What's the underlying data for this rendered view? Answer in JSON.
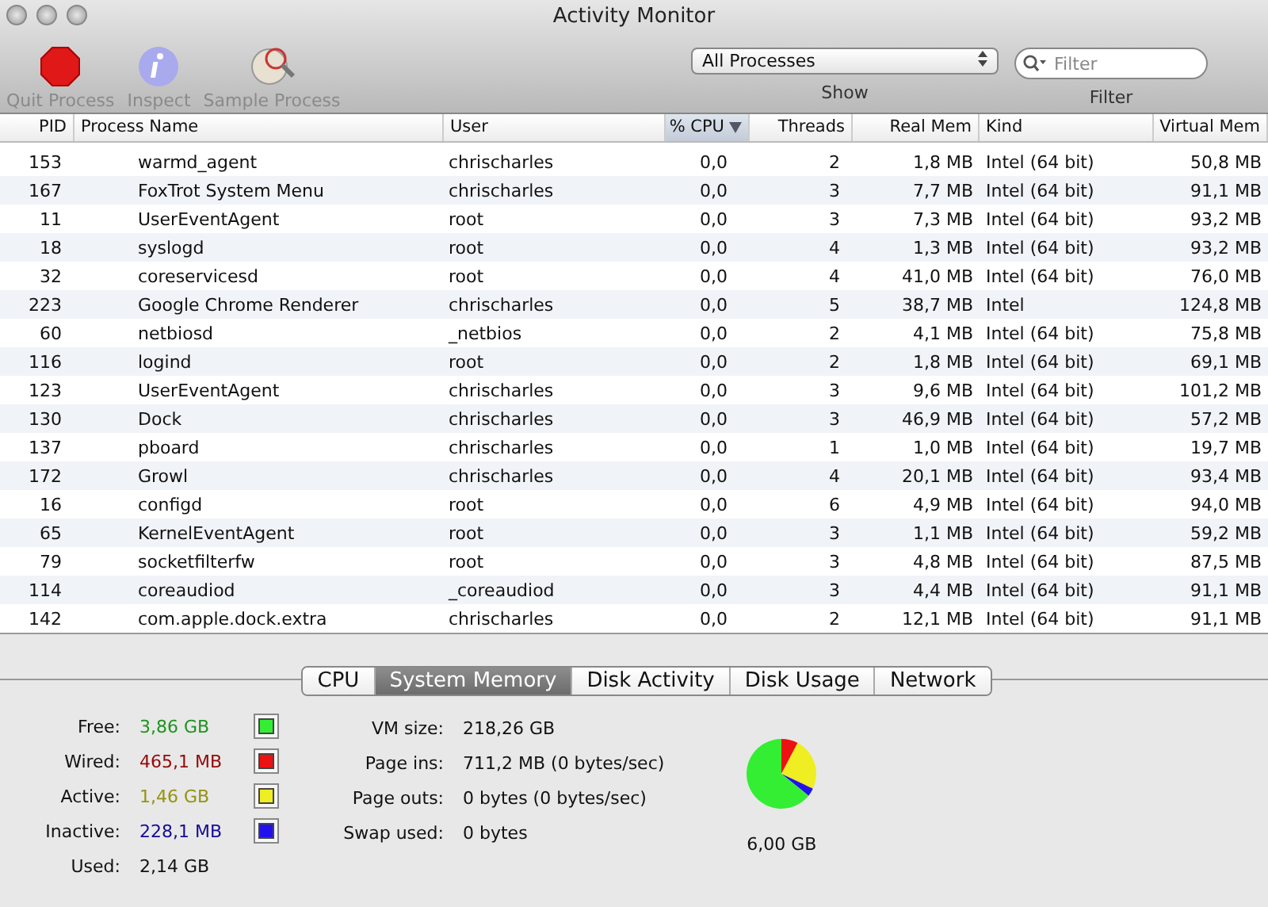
{
  "window": {
    "title": "Activity Monitor"
  },
  "toolbar": {
    "buttons": [
      {
        "label": "Quit Process",
        "kind": "quit",
        "disabled": true
      },
      {
        "label": "Inspect",
        "kind": "inspect",
        "disabled": true
      },
      {
        "label": "Sample Process",
        "kind": "sample",
        "disabled": true
      }
    ],
    "show": {
      "value": "All Processes",
      "label": "Show"
    },
    "filter": {
      "placeholder": "Filter",
      "label": "Filter"
    }
  },
  "table": {
    "columns": [
      {
        "label": "PID",
        "selected": false
      },
      {
        "label": "Process Name",
        "selected": false
      },
      {
        "label": "User",
        "selected": false
      },
      {
        "label": "% CPU",
        "selected": true
      },
      {
        "label": "Threads",
        "selected": false
      },
      {
        "label": "Real Mem",
        "selected": false
      },
      {
        "label": "Kind",
        "selected": false
      },
      {
        "label": "Virtual Mem",
        "selected": false
      }
    ],
    "rows": [
      [
        "153",
        "warmd_agent",
        "chrischarles",
        "0,0",
        "2",
        "1,8 MB",
        "Intel (64 bit)",
        "50,8 MB"
      ],
      [
        "167",
        "FoxTrot System Menu",
        "chrischarles",
        "0,0",
        "3",
        "7,7 MB",
        "Intel (64 bit)",
        "91,1 MB"
      ],
      [
        "11",
        "UserEventAgent",
        "root",
        "0,0",
        "3",
        "7,3 MB",
        "Intel (64 bit)",
        "93,2 MB"
      ],
      [
        "18",
        "syslogd",
        "root",
        "0,0",
        "4",
        "1,3 MB",
        "Intel (64 bit)",
        "93,2 MB"
      ],
      [
        "32",
        "coreservicesd",
        "root",
        "0,0",
        "4",
        "41,0 MB",
        "Intel (64 bit)",
        "76,0 MB"
      ],
      [
        "223",
        "Google Chrome Renderer",
        "chrischarles",
        "0,0",
        "5",
        "38,7 MB",
        "Intel",
        "124,8 MB"
      ],
      [
        "60",
        "netbiosd",
        "_netbios",
        "0,0",
        "2",
        "4,1 MB",
        "Intel (64 bit)",
        "75,8 MB"
      ],
      [
        "116",
        "logind",
        "root",
        "0,0",
        "2",
        "1,8 MB",
        "Intel (64 bit)",
        "69,1 MB"
      ],
      [
        "123",
        "UserEventAgent",
        "chrischarles",
        "0,0",
        "3",
        "9,6 MB",
        "Intel (64 bit)",
        "101,2 MB"
      ],
      [
        "130",
        "Dock",
        "chrischarles",
        "0,0",
        "3",
        "46,9 MB",
        "Intel (64 bit)",
        "57,2 MB"
      ],
      [
        "137",
        "pboard",
        "chrischarles",
        "0,0",
        "1",
        "1,0 MB",
        "Intel (64 bit)",
        "19,7 MB"
      ],
      [
        "172",
        "Growl",
        "chrischarles",
        "0,0",
        "4",
        "20,1 MB",
        "Intel (64 bit)",
        "93,4 MB"
      ],
      [
        "16",
        "configd",
        "root",
        "0,0",
        "6",
        "4,9 MB",
        "Intel (64 bit)",
        "94,0 MB"
      ],
      [
        "65",
        "KernelEventAgent",
        "root",
        "0,0",
        "3",
        "1,1 MB",
        "Intel (64 bit)",
        "59,2 MB"
      ],
      [
        "79",
        "socketfilterfw",
        "root",
        "0,0",
        "3",
        "4,8 MB",
        "Intel (64 bit)",
        "87,5 MB"
      ],
      [
        "114",
        "coreaudiod",
        "_coreaudiod",
        "0,0",
        "3",
        "4,4 MB",
        "Intel (64 bit)",
        "91,1 MB"
      ],
      [
        "142",
        "com.apple.dock.extra",
        "chrischarles",
        "0,0",
        "2",
        "12,1 MB",
        "Intel (64 bit)",
        "91,1 MB"
      ]
    ]
  },
  "tabs": [
    {
      "label": "CPU",
      "selected": false
    },
    {
      "label": "System Memory",
      "selected": true
    },
    {
      "label": "Disk Activity",
      "selected": false
    },
    {
      "label": "Disk Usage",
      "selected": false
    },
    {
      "label": "Network",
      "selected": false
    }
  ],
  "memory": {
    "items": [
      {
        "label": "Free:",
        "value": "3,86 GB",
        "color": "#33ee33"
      },
      {
        "label": "Wired:",
        "value": "465,1 MB",
        "color": "#ee1111"
      },
      {
        "label": "Active:",
        "value": "1,46 GB",
        "color": "#eeee22"
      },
      {
        "label": "Inactive:",
        "value": "228,1 MB",
        "color": "#2211ee"
      },
      {
        "label": "Used:",
        "value": "2,14 GB"
      }
    ],
    "stats": [
      {
        "label": "VM size:",
        "value": "218,26 GB"
      },
      {
        "label": "Page ins:",
        "value": "711,2 MB (0 bytes/sec)"
      },
      {
        "label": "Page outs:",
        "value": "0 bytes (0 bytes/sec)"
      },
      {
        "label": "Swap used:",
        "value": "0 bytes"
      }
    ],
    "total": "6,00 GB"
  }
}
